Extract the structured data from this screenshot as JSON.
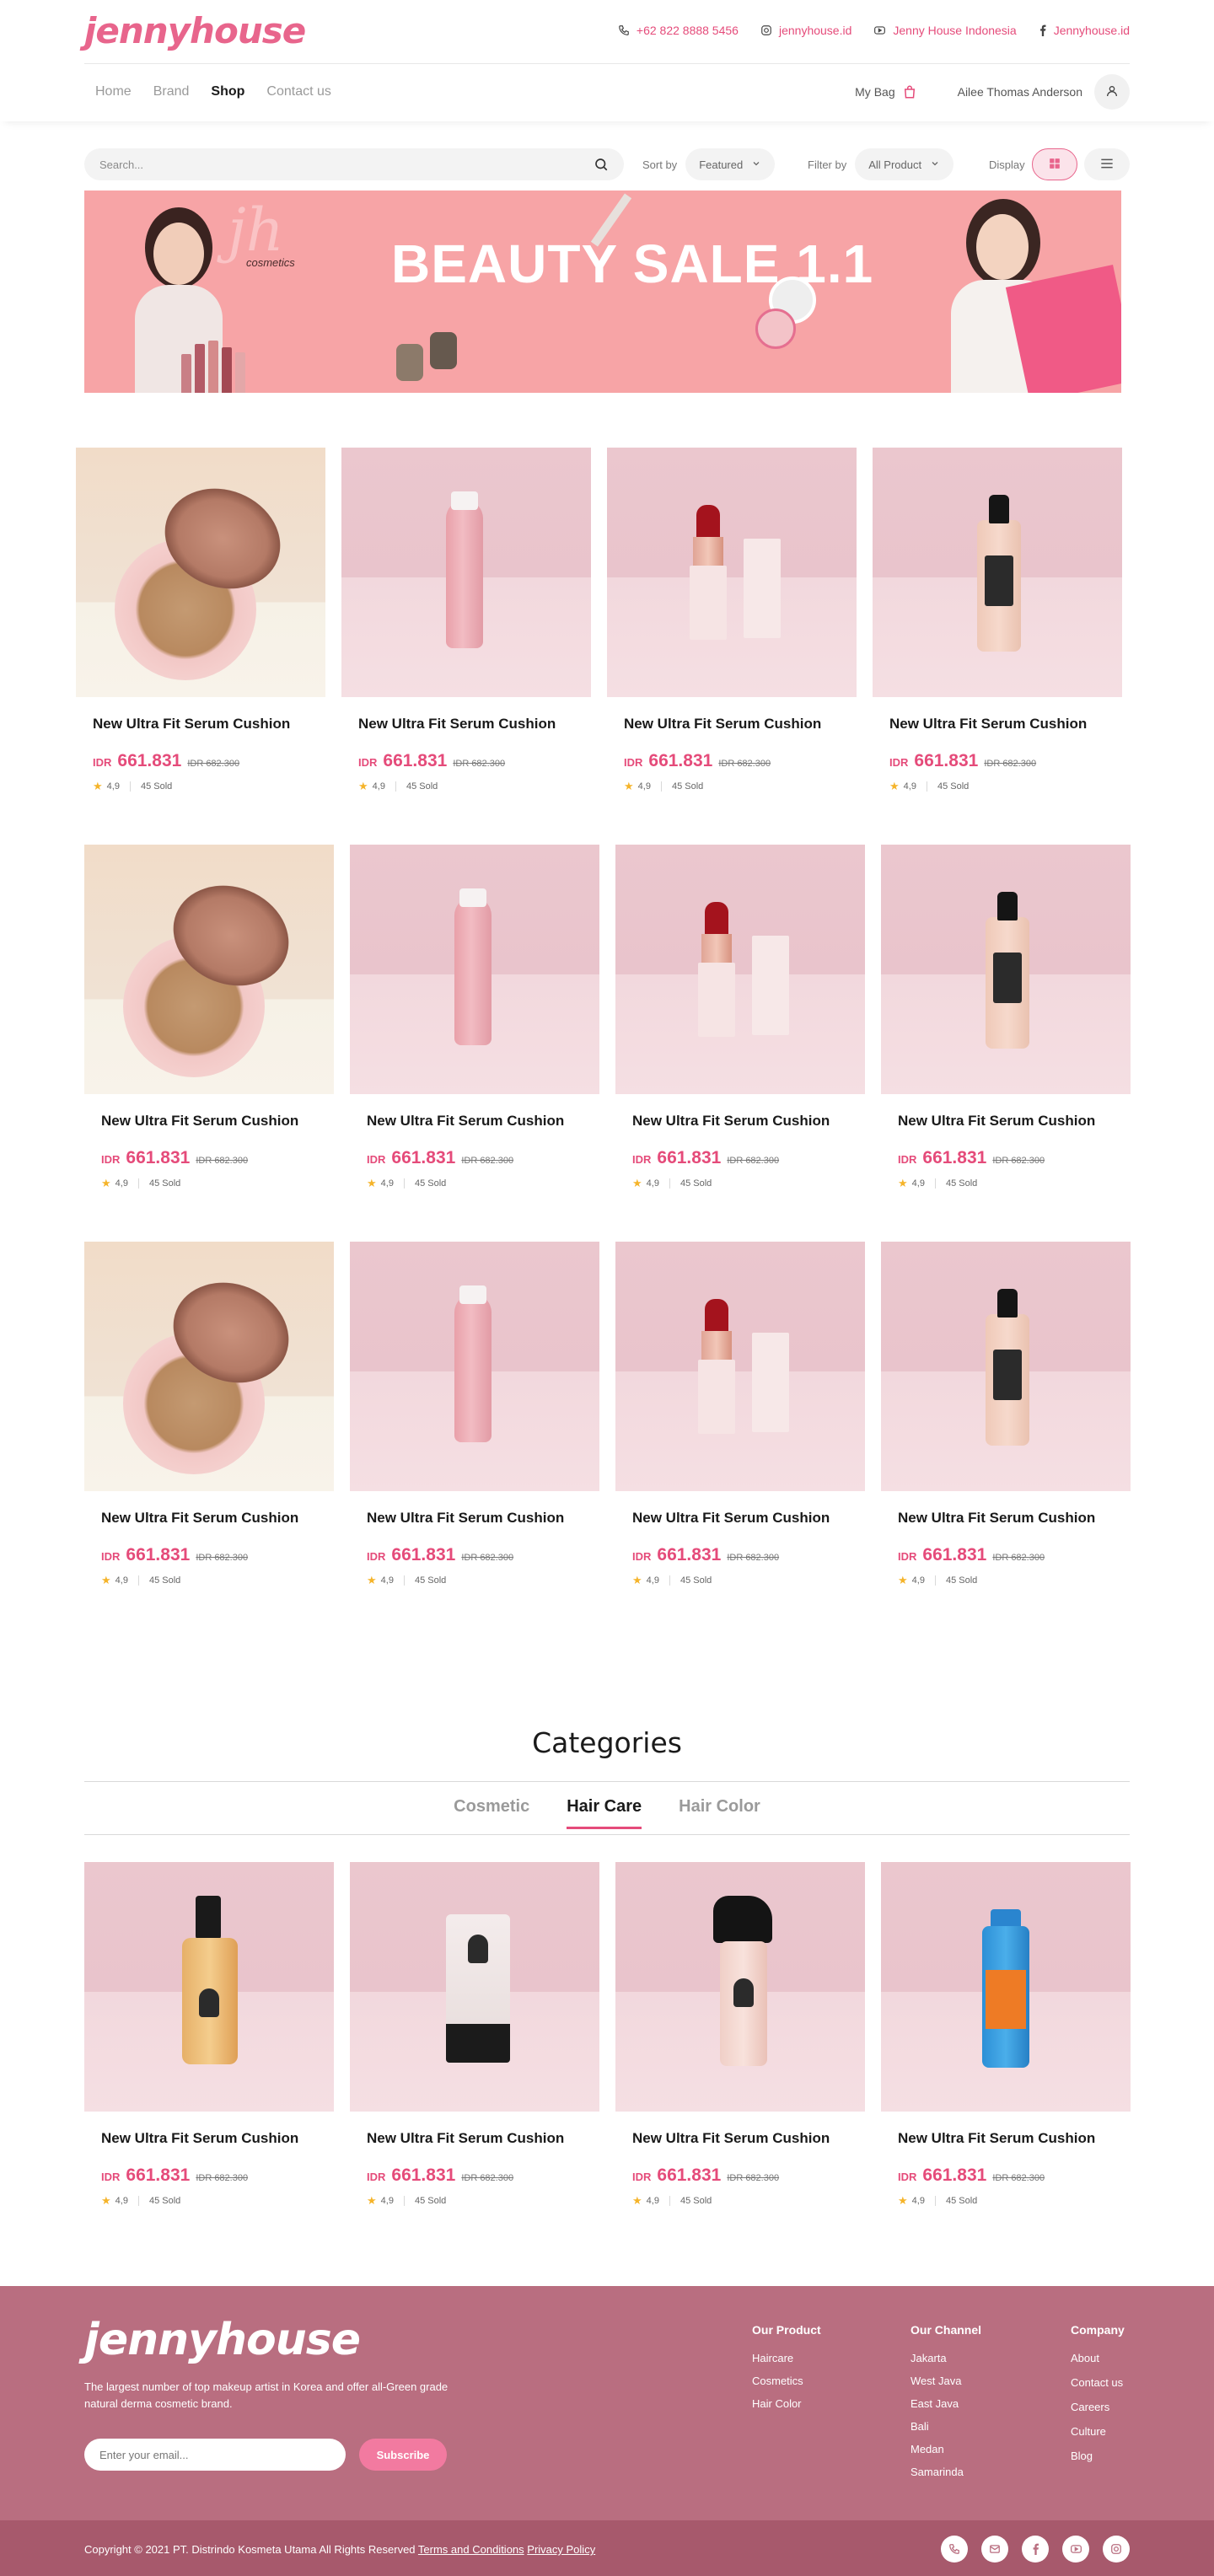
{
  "header": {
    "logo": "jennyhouse",
    "contacts": {
      "phone": "+62 822 8888  5456",
      "instagram": "jennyhouse.id",
      "youtube": "Jenny House Indonesia",
      "facebook": "Jennyhouse.id"
    },
    "nav": [
      {
        "label": "Home",
        "active": false
      },
      {
        "label": "Brand",
        "active": false
      },
      {
        "label": "Shop",
        "active": true
      },
      {
        "label": "Contact us",
        "active": false
      }
    ],
    "bag_label": "My Bag",
    "user_name": "Ailee Thomas Anderson"
  },
  "toolbar": {
    "search_placeholder": "Search...",
    "sort_label": "Sort by",
    "sort_value": "Featured",
    "filter_label": "Filter by",
    "filter_value": "All Product",
    "display_label": "Display"
  },
  "banner": {
    "title": "BEAUTY SALE 1.1",
    "brand_mark": "jh",
    "brand_sub": "cosmetics",
    "bg_color": "#f7a4a6"
  },
  "products": [
    {
      "name": "New Ultra Fit Serum Cushion",
      "currency": "IDR",
      "price": "661.831",
      "old_price": "IDR 682.300",
      "rating": "4,9",
      "sold": "45  Sold",
      "image": "cushion"
    },
    {
      "name": "New Ultra Fit Serum Cushion",
      "currency": "IDR",
      "price": "661.831",
      "old_price": "IDR 682.300",
      "rating": "4,9",
      "sold": "45  Sold",
      "image": "tube"
    },
    {
      "name": "New Ultra Fit Serum Cushion",
      "currency": "IDR",
      "price": "661.831",
      "old_price": "IDR 682.300",
      "rating": "4,9",
      "sold": "45  Sold",
      "image": "lipstick"
    },
    {
      "name": "New Ultra Fit Serum Cushion",
      "currency": "IDR",
      "price": "661.831",
      "old_price": "IDR 682.300",
      "rating": "4,9",
      "sold": "45  Sold",
      "image": "bottle"
    },
    {
      "name": "New Ultra Fit Serum Cushion",
      "currency": "IDR",
      "price": "661.831",
      "old_price": "IDR 682.300",
      "rating": "4,9",
      "sold": "45  Sold",
      "image": "cushion"
    },
    {
      "name": "New Ultra Fit Serum Cushion",
      "currency": "IDR",
      "price": "661.831",
      "old_price": "IDR 682.300",
      "rating": "4,9",
      "sold": "45  Sold",
      "image": "tube"
    },
    {
      "name": "New Ultra Fit Serum Cushion",
      "currency": "IDR",
      "price": "661.831",
      "old_price": "IDR 682.300",
      "rating": "4,9",
      "sold": "45  Sold",
      "image": "lipstick"
    },
    {
      "name": "New Ultra Fit Serum Cushion",
      "currency": "IDR",
      "price": "661.831",
      "old_price": "IDR 682.300",
      "rating": "4,9",
      "sold": "45  Sold",
      "image": "bottle"
    },
    {
      "name": "New Ultra Fit Serum Cushion",
      "currency": "IDR",
      "price": "661.831",
      "old_price": "IDR 682.300",
      "rating": "4,9",
      "sold": "45  Sold",
      "image": "cushion"
    },
    {
      "name": "New Ultra Fit Serum Cushion",
      "currency": "IDR",
      "price": "661.831",
      "old_price": "IDR 682.300",
      "rating": "4,9",
      "sold": "45  Sold",
      "image": "tube"
    },
    {
      "name": "New Ultra Fit Serum Cushion",
      "currency": "IDR",
      "price": "661.831",
      "old_price": "IDR 682.300",
      "rating": "4,9",
      "sold": "45  Sold",
      "image": "lipstick"
    },
    {
      "name": "New Ultra Fit Serum Cushion",
      "currency": "IDR",
      "price": "661.831",
      "old_price": "IDR 682.300",
      "rating": "4,9",
      "sold": "45  Sold",
      "image": "bottle"
    }
  ],
  "categories": {
    "title": "Categories",
    "tabs": [
      {
        "label": "Cosmetic",
        "active": false
      },
      {
        "label": "Hair Care",
        "active": true
      },
      {
        "label": "Hair Color",
        "active": false
      }
    ],
    "products": [
      {
        "name": "New Ultra Fit Serum Cushion",
        "currency": "IDR",
        "price": "661.831",
        "old_price": "IDR 682.300",
        "rating": "4,9",
        "sold": "45  Sold",
        "image": "pump"
      },
      {
        "name": "New Ultra Fit Serum Cushion",
        "currency": "IDR",
        "price": "661.831",
        "old_price": "IDR 682.300",
        "rating": "4,9",
        "sold": "45  Sold",
        "image": "squeeze-tube"
      },
      {
        "name": "New Ultra Fit Serum Cushion",
        "currency": "IDR",
        "price": "661.831",
        "old_price": "IDR 682.300",
        "rating": "4,9",
        "sold": "45  Sold",
        "image": "spray"
      },
      {
        "name": "New Ultra Fit Serum Cushion",
        "currency": "IDR",
        "price": "661.831",
        "old_price": "IDR 682.300",
        "rating": "4,9",
        "sold": "45  Sold",
        "image": "blue-bottle"
      }
    ]
  },
  "footer": {
    "logo": "jennyhouse",
    "description": "The largest number of top makeup artist in Korea and offer all-Green grade natural derma cosmetic brand.",
    "email_placeholder": "Enter your email...",
    "subscribe_label": "Subscribe",
    "columns": [
      {
        "title": "Our Product",
        "items": [
          "Haircare",
          "Cosmetics",
          "Hair Color"
        ]
      },
      {
        "title": "Our Channel",
        "items": [
          "Jakarta",
          "West Java",
          "East Java",
          "Bali",
          "Medan",
          "Samarinda"
        ]
      },
      {
        "title": "Company",
        "items": [
          "About",
          "Contact us",
          "Careers",
          "Culture",
          "Blog"
        ]
      }
    ],
    "copyright": "Copyright © 2021 PT. Distrindo Kosmeta Utama All Rights Reserved",
    "terms_label": "Terms and Conditions",
    "privacy_label": "Privacy Policy",
    "socials": [
      "phone-icon",
      "mail-icon",
      "facebook-icon",
      "youtube-icon",
      "instagram-icon"
    ]
  },
  "colors": {
    "accent": "#e54b7a",
    "footer_bg": "#b96e80",
    "footer_bottom_bg": "#a7596c",
    "star": "#f5b42a"
  }
}
